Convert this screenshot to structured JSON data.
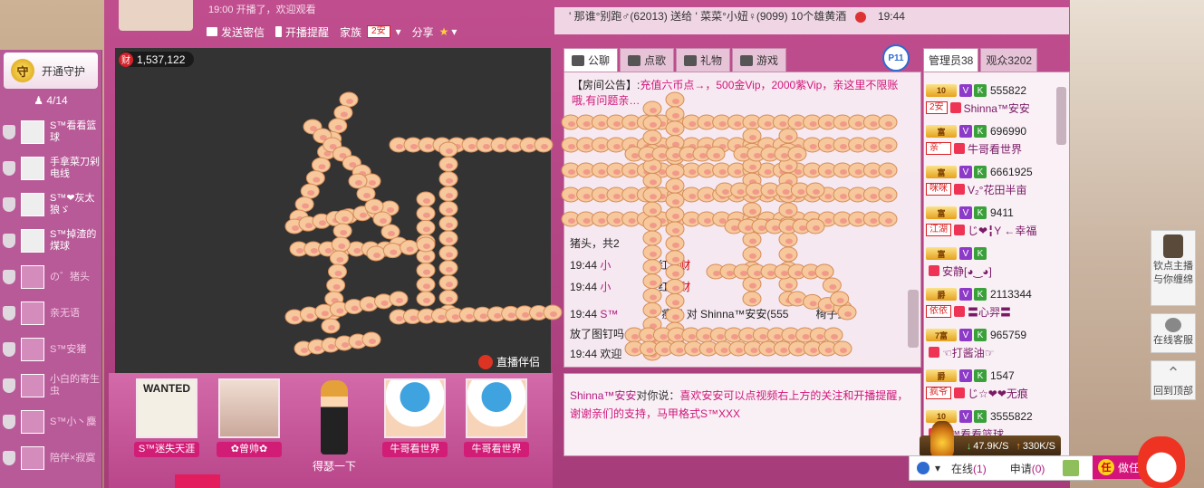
{
  "header": {
    "top_line": "19:00 开播了，欢迎观看",
    "toolbar": {
      "send_msg": "发送密信",
      "broadcast_remind": "开播提醒",
      "family_label": "家族",
      "family_tag": "2安",
      "share": "分享"
    }
  },
  "guard": {
    "open_label": "开通守护",
    "badge": "守",
    "count": "4/14",
    "items": [
      {
        "name": "S™看看篮球"
      },
      {
        "name": "手拿菜刀剁电线"
      },
      {
        "name": "S™❤灰太狼ゞ"
      },
      {
        "name": "S™掉渣的煤球"
      },
      {
        "name": "の゛猪头"
      },
      {
        "name": "亲无语"
      },
      {
        "name": "S™安猪"
      },
      {
        "name": "小白的寄生虫"
      },
      {
        "name": "S™小丶麋"
      },
      {
        "name": "陪伴×寂寞"
      }
    ]
  },
  "video": {
    "wealth_badge": "财",
    "wealth_value": "1,537,122",
    "live_logo": "直播伴侣"
  },
  "stage": {
    "fans": [
      {
        "name": "S™迷失天涯",
        "pic_text": "WANTED"
      },
      {
        "name": "✿曾帅✿"
      },
      {
        "name": "牛哥看世界"
      },
      {
        "name": "牛哥看世界"
      }
    ],
    "center_caption": "得瑟一下"
  },
  "chat": {
    "ticker": "' 那谁°别跑♂(62013) 送给 ' 菜菜°小妞♀(9099) 10个雄黄酒",
    "ticker_time": "19:44",
    "tabs": [
      "公聊",
      "点歌",
      "礼物",
      "游戏"
    ],
    "p_badge": "P11",
    "notice_label": "【房间公告】:",
    "notice_text": "充值六币点→，500金Vip，2000紫Vip，亲这里不限账哦,有问题亲…",
    "lines": [
      {
        "time": "猪头，共2",
        "who": "",
        "text": ""
      },
      {
        "time": "19:44",
        "who": "小",
        "text": "个红包",
        "red": "财"
      },
      {
        "time": "19:44",
        "who": "小",
        "text": "个红包",
        "red": "财"
      },
      {
        "time": "19:44",
        "who": "S™",
        "text": "瘦了 对 Shinna™安安(555",
        "tail": "椅子上"
      },
      {
        "time": "放了图钉吗",
        "who": "",
        "text": ""
      },
      {
        "time": "19:44",
        "who": "",
        "text": "欢迎"
      }
    ],
    "private": {
      "from": "Shinna™安安",
      "mid": "对你说：",
      "text": "喜欢安安可以点视频右上方的关注和开播提醒，谢谢亲们的支持，马甲格式S™XXX"
    }
  },
  "users": {
    "tab_admin": "管理员38",
    "tab_audience": "观众3202",
    "rows": [
      {
        "lvl": "10",
        "id": "555822",
        "fam": "2安",
        "nick": "Shinna™安安"
      },
      {
        "lvl": "富",
        "id": "696990",
        "fam": "亲゛",
        "nick": "牛哥看世界"
      },
      {
        "lvl": "富",
        "id": "6661925",
        "fam": "咪咪",
        "nick": "V₂°花田半亩"
      },
      {
        "lvl": "富",
        "id": "9411",
        "fam": "江湖",
        "nick": "じ❤╏Y ←幸福"
      },
      {
        "lvl": "富",
        "id": "",
        "fam": "",
        "nick": "安静[◕‿◕]"
      },
      {
        "lvl": "爵",
        "id": "2113344",
        "fam": "依依",
        "nick": "〓心羿〓"
      },
      {
        "lvl": "7富",
        "id": "965759",
        "fam": "",
        "nick": "☜打酱油☞"
      },
      {
        "lvl": "爵",
        "id": "1547",
        "fam": "疯爷",
        "nick": "じ☆❤❤无痕"
      },
      {
        "lvl": "10",
        "id": "3555822",
        "fam": "",
        "nick": "S™看看篮球"
      }
    ],
    "speed_down": "47.9K/S",
    "speed_up": "330K/S"
  },
  "bottom": {
    "online_label": "在线",
    "online_count": "(1)",
    "apply_label": "申请",
    "apply_count": "(0)",
    "task_badge": "任",
    "task_label": "做任"
  },
  "float_buttons": {
    "anchor": "钦点主播与你缠绵",
    "service": "在线客服",
    "top": "回到顶部"
  },
  "colors": {
    "room_bg": "#b0407f",
    "accent": "#d0167a",
    "pig": "#f6c89b"
  }
}
